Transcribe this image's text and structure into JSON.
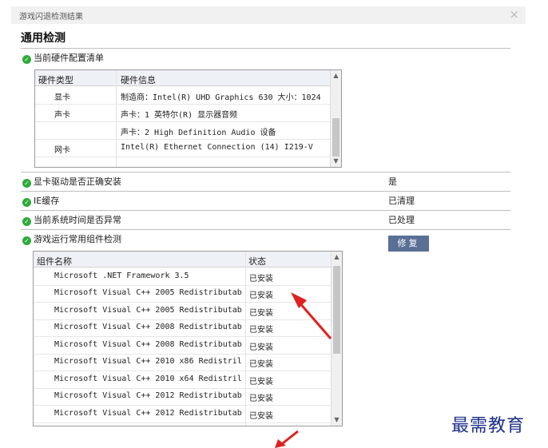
{
  "window": {
    "title": "游戏闪退检测结果",
    "close_glyph": "×"
  },
  "heading": "通用检测",
  "hardware": {
    "label": "当前硬件配置清单",
    "columns": [
      "硬件类型",
      "硬件信息"
    ],
    "rows": [
      {
        "type": "显卡",
        "info": "制造商：Intel(R) UHD Graphics 630 大小：1024"
      },
      {
        "type": "声卡",
        "info": "声卡：1 英特尔(R) 显示器音频"
      },
      {
        "type": "",
        "info": "声卡：2 High Definition Audio 设备"
      },
      {
        "type": "网卡",
        "info": "Intel(R) Ethernet Connection (14) I219-V"
      }
    ]
  },
  "checks": [
    {
      "label": "显卡驱动是否正确安装",
      "value": "是"
    },
    {
      "label": "IE缓存",
      "value": "已清理"
    },
    {
      "label": "当前系统时间是否异常",
      "value": "已处理"
    },
    {
      "label": "游戏运行常用组件检测",
      "value": ""
    }
  ],
  "repair_label": "修复",
  "components": {
    "columns": [
      "组件名称",
      "状态"
    ],
    "rows": [
      {
        "name": "Microsoft .NET Framework 3.5",
        "status": "已安装"
      },
      {
        "name": "Microsoft Visual C++ 2005 Redistributab",
        "status": "已安装"
      },
      {
        "name": "Microsoft Visual C++ 2005 Redistributab",
        "status": "已安装"
      },
      {
        "name": "Microsoft Visual C++ 2008 Redistributab",
        "status": "已安装"
      },
      {
        "name": "Microsoft Visual C++ 2008 Redistributab",
        "status": "已安装"
      },
      {
        "name": "Microsoft Visual C++ 2010  x86 Redistril",
        "status": "已安装"
      },
      {
        "name": "Microsoft Visual C++ 2010  x64 Redistril",
        "status": "已安装"
      },
      {
        "name": "Microsoft Visual C++ 2012 Redistributab",
        "status": "已安装"
      },
      {
        "name": "Microsoft Visual C++ 2012 Redistributab",
        "status": "已安装"
      }
    ]
  },
  "watermark": "最需教育",
  "colors": {
    "ok_green": "#2eaa3b",
    "button": "#5a6f96",
    "arrow": "#e02020",
    "watermark": "#1c2e8a"
  }
}
